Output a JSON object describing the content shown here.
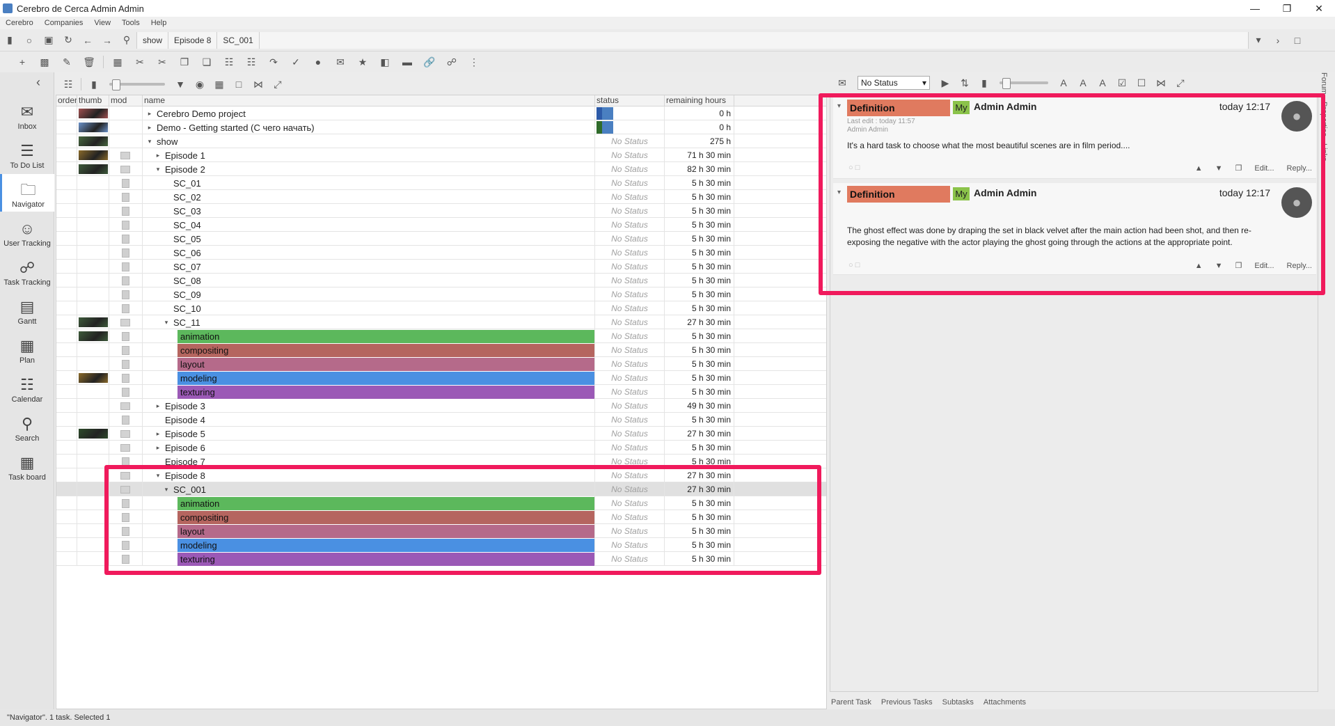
{
  "window": {
    "title": "Cerebro de Cerca  Admin Admin"
  },
  "menu": [
    "Cerebro",
    "Companies",
    "View",
    "Tools",
    "Help"
  ],
  "breadcrumbs": [
    "show",
    "Episode 8",
    "SC_001"
  ],
  "sidebar": [
    {
      "label": "Inbox",
      "icon": "envelope-icon"
    },
    {
      "label": "To Do List",
      "icon": "todo-icon"
    },
    {
      "label": "Navigator",
      "icon": "folder-icon",
      "active": true
    },
    {
      "label": "User Tracking",
      "icon": "users-icon"
    },
    {
      "label": "Task Tracking",
      "icon": "task-tracking-icon"
    },
    {
      "label": "Gantt",
      "icon": "gantt-icon"
    },
    {
      "label": "Plan",
      "icon": "plan-icon"
    },
    {
      "label": "Calendar",
      "icon": "calendar-icon"
    },
    {
      "label": "Search",
      "icon": "search-icon"
    },
    {
      "label": "Task board",
      "icon": "taskboard-icon"
    }
  ],
  "tree": {
    "columns": {
      "order": "order",
      "thumb": "thumb",
      "mod": "mod",
      "name": "name",
      "status": "status",
      "remaining": "remaining hours"
    },
    "rows": [
      {
        "name": "Cerebro Demo project",
        "indent": 0,
        "expand": "closed",
        "status": "",
        "bars": [
          "#2d5aa8",
          "#4a7fc1"
        ],
        "rem": "0 h",
        "thumb": "#a05050",
        "icon": "none"
      },
      {
        "name": "Demo - Getting started (С чего начать)",
        "indent": 0,
        "expand": "closed",
        "status": "",
        "bars": [
          "#2f6b2a",
          "#4a7fc1"
        ],
        "rem": "0 h",
        "thumb": "#6a90c8",
        "icon": "none"
      },
      {
        "name": "show",
        "indent": 0,
        "expand": "open",
        "status": "No Status",
        "rem": "275 h",
        "thumb": "#46663e",
        "icon": "none"
      },
      {
        "name": "Episode 1",
        "indent": 1,
        "expand": "closed",
        "status": "No Status",
        "rem": "71 h 30 min",
        "thumb": "#8a6a2a",
        "icon": "folder"
      },
      {
        "name": "Episode 2",
        "indent": 1,
        "expand": "open",
        "status": "No Status",
        "rem": "82 h 30 min",
        "thumb": "#3d5a3a",
        "icon": "folder"
      },
      {
        "name": "SC_01",
        "indent": 2,
        "status": "No Status",
        "rem": "5 h 30 min",
        "icon": "doc"
      },
      {
        "name": "SC_02",
        "indent": 2,
        "status": "No Status",
        "rem": "5 h 30 min",
        "icon": "doc"
      },
      {
        "name": "SC_03",
        "indent": 2,
        "status": "No Status",
        "rem": "5 h 30 min",
        "icon": "doc"
      },
      {
        "name": "SC_04",
        "indent": 2,
        "status": "No Status",
        "rem": "5 h 30 min",
        "icon": "doc"
      },
      {
        "name": "SC_05",
        "indent": 2,
        "status": "No Status",
        "rem": "5 h 30 min",
        "icon": "doc"
      },
      {
        "name": "SC_06",
        "indent": 2,
        "status": "No Status",
        "rem": "5 h 30 min",
        "icon": "doc"
      },
      {
        "name": "SC_07",
        "indent": 2,
        "status": "No Status",
        "rem": "5 h 30 min",
        "icon": "doc"
      },
      {
        "name": "SC_08",
        "indent": 2,
        "status": "No Status",
        "rem": "5 h 30 min",
        "icon": "doc"
      },
      {
        "name": "SC_09",
        "indent": 2,
        "status": "No Status",
        "rem": "5 h 30 min",
        "icon": "doc"
      },
      {
        "name": "SC_10",
        "indent": 2,
        "status": "No Status",
        "rem": "5 h 30 min",
        "icon": "doc"
      },
      {
        "name": "SC_11",
        "indent": 2,
        "expand": "open",
        "status": "No Status",
        "rem": "27 h 30 min",
        "thumb": "#3d5a3a",
        "icon": "folder"
      },
      {
        "name": "animation",
        "task": "#5cb85c",
        "status": "No Status",
        "rem": "5 h 30 min",
        "thumb": "#3d5a3a",
        "icon": "doc"
      },
      {
        "name": "compositing",
        "task": "#b5655f",
        "status": "No Status",
        "rem": "5 h 30 min",
        "icon": "doc"
      },
      {
        "name": "layout",
        "task": "#b56a8a",
        "status": "No Status",
        "rem": "5 h 30 min",
        "icon": "doc"
      },
      {
        "name": "modeling",
        "task": "#4a90e2",
        "status": "No Status",
        "rem": "5 h 30 min",
        "thumb": "#8a6a2a",
        "icon": "doc"
      },
      {
        "name": "texturing",
        "task": "#9b59b6",
        "status": "No Status",
        "rem": "5 h 30 min",
        "icon": "doc"
      },
      {
        "name": "Episode 3",
        "indent": 1,
        "expand": "closed",
        "status": "No Status",
        "rem": "49 h 30 min",
        "icon": "folder"
      },
      {
        "name": "Episode 4",
        "indent": 1,
        "status": "No Status",
        "rem": "5 h 30 min",
        "icon": "doc"
      },
      {
        "name": "Episode 5",
        "indent": 1,
        "expand": "closed",
        "status": "No Status",
        "rem": "27 h 30 min",
        "thumb": "#2d4a2a",
        "icon": "folder"
      },
      {
        "name": "Episode 6",
        "indent": 1,
        "expand": "closed",
        "status": "No Status",
        "rem": "5 h 30 min",
        "icon": "folder"
      },
      {
        "name": "Episode 7",
        "indent": 1,
        "status": "No Status",
        "rem": "5 h 30 min",
        "icon": "doc"
      },
      {
        "name": "Episode 8",
        "indent": 1,
        "expand": "open",
        "status": "No Status",
        "rem": "27 h 30 min",
        "icon": "folder"
      },
      {
        "name": "SC_001",
        "indent": 2,
        "expand": "open",
        "status": "No Status",
        "rem": "27 h 30 min",
        "icon": "folder",
        "selected": true
      },
      {
        "name": "animation",
        "task": "#5cb85c",
        "status": "No Status",
        "rem": "5 h 30 min",
        "icon": "doc"
      },
      {
        "name": "compositing",
        "task": "#b5655f",
        "status": "No Status",
        "rem": "5 h 30 min",
        "icon": "doc"
      },
      {
        "name": "layout",
        "task": "#b56a8a",
        "status": "No Status",
        "rem": "5 h 30 min",
        "icon": "doc"
      },
      {
        "name": "modeling",
        "task": "#4a90e2",
        "status": "No Status",
        "rem": "5 h 30 min",
        "icon": "doc"
      },
      {
        "name": "texturing",
        "task": "#9b59b6",
        "status": "No Status",
        "rem": "5 h 30 min",
        "icon": "doc"
      }
    ]
  },
  "forum": {
    "status_select": "No Status",
    "messages": [
      {
        "tag": "Definition",
        "my": "My",
        "author": "Admin Admin",
        "time": "today 12:17",
        "last_edit": "Last edit : today 11:57",
        "last_edit_by": "Admin Admin",
        "body": "It's a hard task to choose what the most beautiful scenes are in film period....",
        "edit": "Edit...",
        "reply": "Reply..."
      },
      {
        "tag": "Definition",
        "my": "My",
        "author": "Admin Admin",
        "time": "today 12:17",
        "body": "The ghost effect was done by draping the set in black velvet after the main action had been shot, and then re-exposing the negative with the actor playing the ghost going through the actions at the appropriate point.",
        "edit": "Edit...",
        "reply": "Reply..."
      }
    ],
    "tabs": [
      "Parent Task",
      "Previous Tasks",
      "Subtasks",
      "Attachments"
    ],
    "side_tabs": [
      "Forum",
      "Properties",
      "Links"
    ]
  },
  "statusbar": {
    "text": "\"Navigator\". 1 task. Selected 1"
  }
}
